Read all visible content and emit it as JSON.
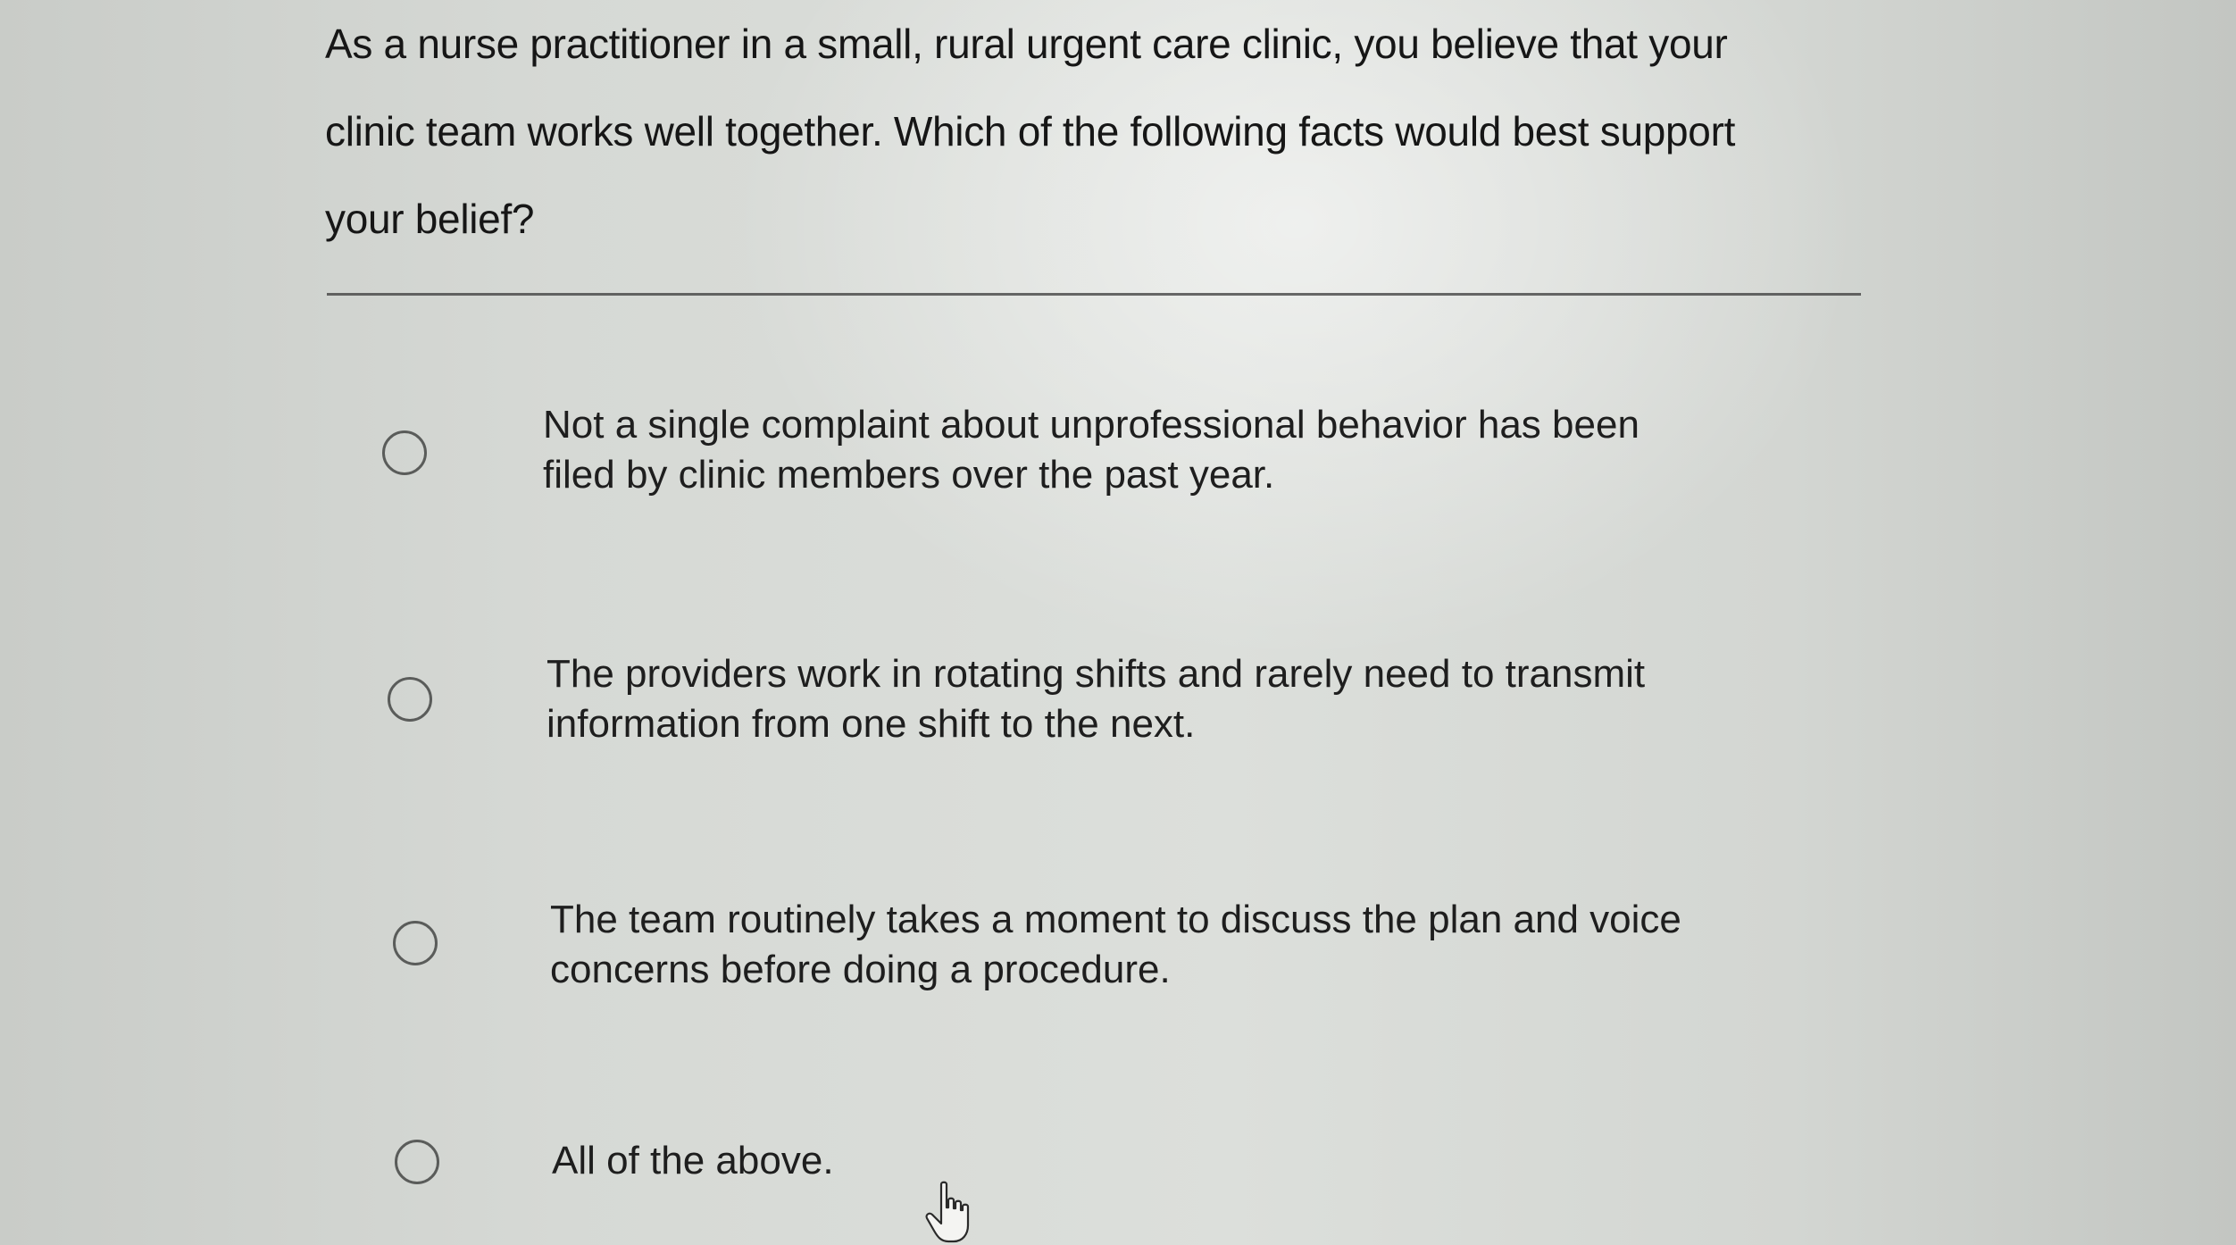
{
  "question": {
    "line1": "As a nurse practitioner in a small, rural urgent care clinic, you believe that your",
    "line2": "clinic team works well together. Which of the following facts would best support",
    "line3": "your belief?"
  },
  "options": [
    {
      "line1": "Not a single complaint about unprofessional behavior has been",
      "line2": "filed by clinic members over the past year.",
      "selected": false
    },
    {
      "line1": "The providers work in rotating shifts and rarely need to transmit",
      "line2": "information from one shift to the next.",
      "selected": false
    },
    {
      "line1": "The team routinely takes a moment to discuss the plan and voice",
      "line2": "concerns before doing a procedure.",
      "selected": false
    },
    {
      "line1": "All of the above.",
      "selected": false
    }
  ],
  "icons": {
    "cursor": "pointer-hand-icon",
    "radio": "radio-button-icon"
  },
  "colors": {
    "text": "#1c1c1c",
    "radio_border": "#5a5c5a",
    "divider": "#3a3a3a"
  }
}
